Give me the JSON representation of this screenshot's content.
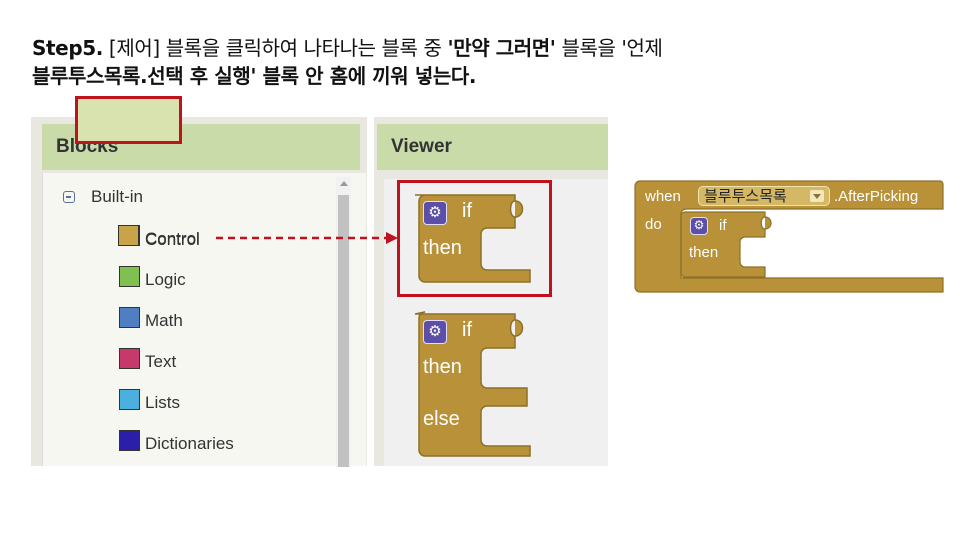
{
  "instruction": {
    "step": "Step5.",
    "part1": " [제어] 블록을 클릭하여 나타나는 블록 중 ",
    "highlight1": "'만약 그러면'",
    "part2": " 블록을 '언제",
    "line2_bold": "블루투스목록.선택 후 실행'",
    "line2_rest": " 블록 안 홈에 끼워 넣는다."
  },
  "blocks_panel": {
    "title": "Blocks",
    "root_label": "Built-in",
    "categories": [
      {
        "label": "Control",
        "color": "#c8a348"
      },
      {
        "label": "Logic",
        "color": "#7fc050"
      },
      {
        "label": "Math",
        "color": "#4f7fc3"
      },
      {
        "label": "Text",
        "color": "#c8396b"
      },
      {
        "label": "Lists",
        "color": "#4bb0dd"
      },
      {
        "label": "Dictionaries",
        "color": "#2b1ea8"
      }
    ]
  },
  "viewer_panel": {
    "title": "Viewer",
    "if_then_block": {
      "if_label": "if",
      "then_label": "then"
    },
    "if_then_else_block": {
      "if_label": "if",
      "then_label": "then",
      "else_label": "else"
    }
  },
  "event_block": {
    "when_label": "when",
    "component": "블루투스목록",
    "event": ".AfterPicking",
    "do_label": "do",
    "inner_if": "if",
    "inner_then": "then"
  },
  "colors": {
    "control_block": "#b89138",
    "highlight_red": "#c0111f",
    "header_green": "#c9dba8"
  }
}
